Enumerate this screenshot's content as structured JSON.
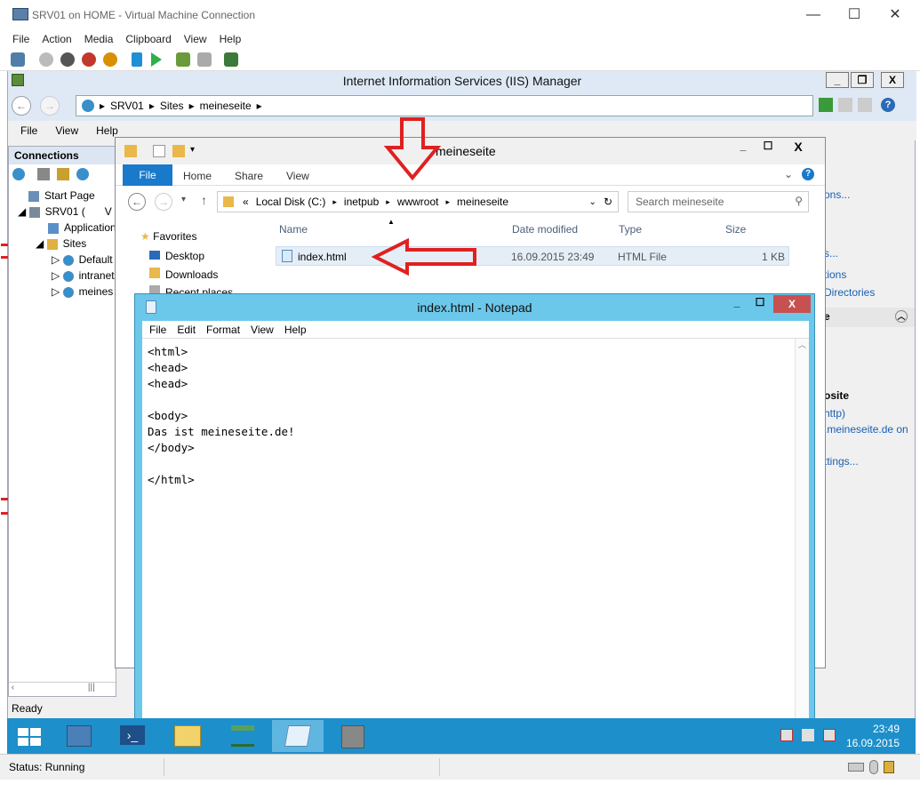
{
  "vm": {
    "title": "SRV01 on HOME - Virtual Machine Connection",
    "menu": [
      "File",
      "Action",
      "Media",
      "Clipboard",
      "View",
      "Help"
    ],
    "status": "Status: Running"
  },
  "iis": {
    "title": "Internet Information Services (IIS) Manager",
    "breadcrumb": [
      "SRV01",
      "Sites",
      "meineseite"
    ],
    "menu": [
      "File",
      "View",
      "Help"
    ],
    "connections_header": "Connections",
    "tree": [
      "Start Page",
      "SRV01 (",
      "Application",
      "Sites",
      "Default",
      "intranet",
      "meines"
    ],
    "tree_extra": "V",
    "right_panel": [
      "ons...",
      "s...",
      "tions",
      "Directories",
      "e",
      "osite",
      "http)",
      ".meineseite.de on",
      "ttings..."
    ],
    "status": "Ready"
  },
  "explorer": {
    "title": "meineseite",
    "tabs": [
      "File",
      "Home",
      "Share",
      "View"
    ],
    "path": [
      "«",
      "Local Disk (C:)",
      "inetpub",
      "wwwroot",
      "meineseite"
    ],
    "search_placeholder": "Search meineseite",
    "nav": [
      "Favorites",
      "Desktop",
      "Downloads",
      "Recent places"
    ],
    "columns": [
      "Name",
      "Date modified",
      "Type",
      "Size"
    ],
    "file": {
      "name": "index.html",
      "date": "16.09.2015 23:49",
      "type": "HTML File",
      "size": "1 KB"
    }
  },
  "notepad": {
    "title": "index.html - Notepad",
    "menu": [
      "File",
      "Edit",
      "Format",
      "View",
      "Help"
    ],
    "content": "<html>\n<head>\n<head>\n\n<body>\nDas ist meineseite.de!\n</body>\n\n</html>"
  },
  "taskbar": {
    "time": "23:49",
    "date": "16.09.2015"
  },
  "colors": {
    "taskbar": "#1d8fca",
    "notepad_frame": "#6cc8ea",
    "arrow": "#e02020",
    "ribbon_file": "#1979ca"
  }
}
